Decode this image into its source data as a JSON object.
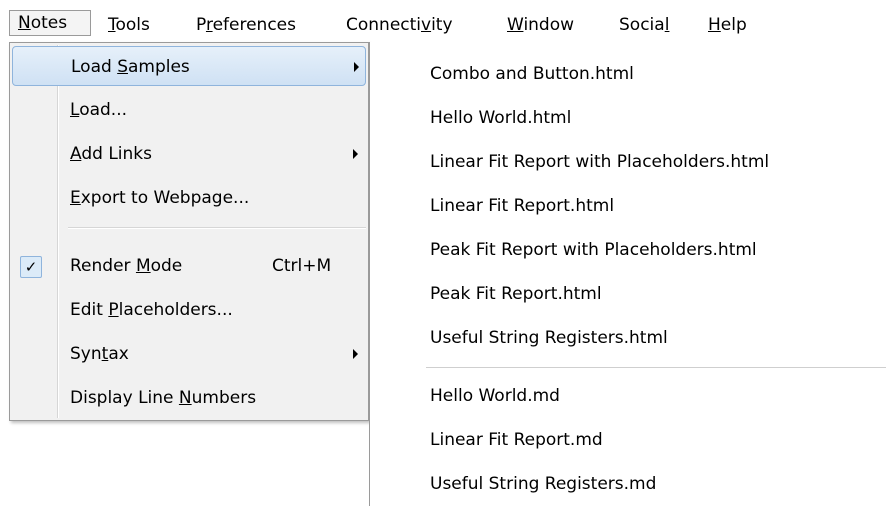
{
  "menubar": {
    "items": [
      {
        "pre": "",
        "u": "N",
        "post": "otes",
        "active": true
      },
      {
        "pre": "",
        "u": "T",
        "post": "ools"
      },
      {
        "pre": "P",
        "u": "r",
        "post": "eferences"
      },
      {
        "pre": "Connecti",
        "u": "v",
        "post": "ity"
      },
      {
        "pre": "",
        "u": "W",
        "post": "indow"
      },
      {
        "pre": "Socia",
        "u": "l",
        "post": ""
      },
      {
        "pre": "",
        "u": "H",
        "post": "elp"
      }
    ]
  },
  "notes_menu": {
    "items": [
      {
        "pre": "Load ",
        "u": "S",
        "post": "amples",
        "submenu": true,
        "highlighted": true
      },
      {
        "pre": "",
        "u": "L",
        "post": "oad..."
      },
      {
        "pre": "",
        "u": "A",
        "post": "dd Links",
        "submenu": true
      },
      {
        "pre": "",
        "u": "E",
        "post": "xport to Webpage..."
      },
      {
        "pre": "Render ",
        "u": "M",
        "post": "ode",
        "shortcut": "Ctrl+M",
        "checked": true,
        "check_glyph": "✓"
      },
      {
        "pre": "Edit ",
        "u": "P",
        "post": "laceholders..."
      },
      {
        "pre": "Syn",
        "u": "t",
        "post": "ax",
        "submenu": true
      },
      {
        "pre": "Display Line ",
        "u": "N",
        "post": "umbers"
      }
    ]
  },
  "samples_menu": {
    "items": [
      "Combo and Button.html",
      "Hello World.html",
      "Linear Fit Report with Placeholders.html",
      "Linear Fit Report.html",
      "Peak Fit Report with Placeholders.html",
      "Peak Fit Report.html",
      "Useful String Registers.html",
      "Hello World.md",
      "Linear Fit Report.md",
      "Useful String Registers.md"
    ]
  }
}
